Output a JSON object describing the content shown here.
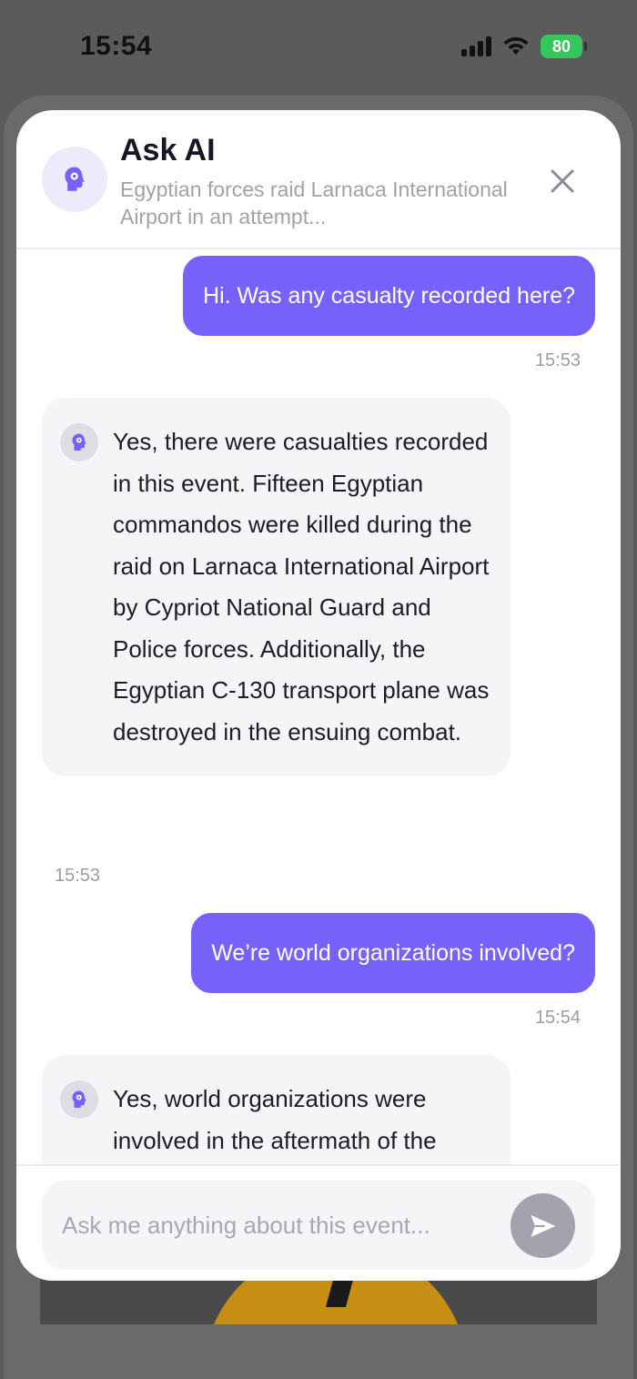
{
  "status_bar": {
    "time": "15:54",
    "battery": "80"
  },
  "header": {
    "title": "Ask AI",
    "subtitle": "Egyptian forces raid Larnaca International Airport in an attempt..."
  },
  "messages": [
    {
      "role": "user",
      "text": "Hi. Was any casualty recorded here?",
      "time": "15:53"
    },
    {
      "role": "ai",
      "text": "Yes, there were casualties recorded in this event. Fifteen Egyptian commandos were killed during the raid on Larnaca International Airport by Cypriot National Guard and Police forces. Additionally, the Egyptian C-130 transport plane was destroyed in the ensuing combat.",
      "time": "15:53"
    },
    {
      "role": "user",
      "text": "We’re world organizations involved?",
      "time": "15:54"
    },
    {
      "role": "ai",
      "text": "Yes, world organizations were involved in the aftermath of the"
    }
  ],
  "input": {
    "placeholder": "Ask me anything about this event..."
  },
  "icons": {
    "header_avatar": "ai-head-gear-icon",
    "close": "close-icon",
    "message_avatar": "ai-head-gear-icon",
    "send": "send-icon"
  },
  "colors": {
    "accent": "#7662fb",
    "avatar_bg": "#ecebfb",
    "ai_bubble": "#f5f5f8",
    "send_disabled": "#a3a3ad",
    "battery": "#34c759"
  }
}
